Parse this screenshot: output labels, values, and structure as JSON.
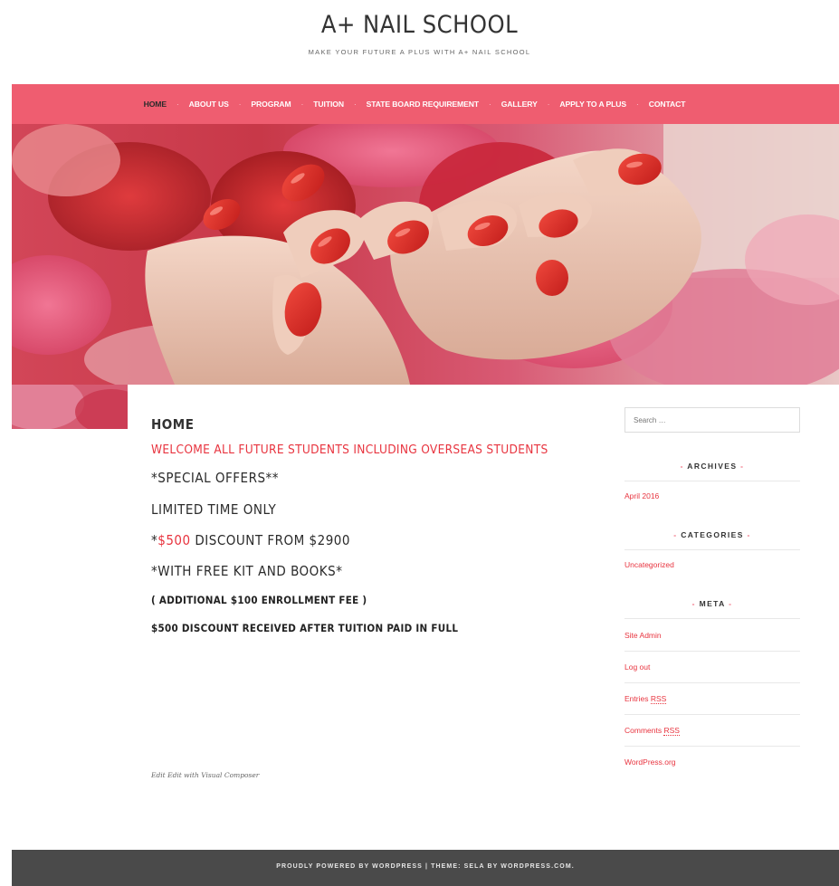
{
  "site": {
    "title": "A+ NAIL SCHOOL",
    "tagline": "MAKE YOUR FUTURE A PLUS WITH A+ NAIL SCHOOL"
  },
  "nav": {
    "items": [
      {
        "label": "HOME"
      },
      {
        "label": "ABOUT US"
      },
      {
        "label": "PROGRAM"
      },
      {
        "label": "TUITION"
      },
      {
        "label": "STATE BOARD REQUIREMENT"
      },
      {
        "label": "GALLERY"
      },
      {
        "label": "APPLY TO A PLUS"
      },
      {
        "label": "CONTACT"
      }
    ],
    "separator": "·",
    "active_color": "#2b2b2b"
  },
  "colors": {
    "accent": "#ef5d70",
    "highlight_red": "#e8343f",
    "footer_bg": "#4a4a4a"
  },
  "content": {
    "title": "HOME",
    "welcome": "WELCOME ALL FUTURE STUDENTS INCLUDING OVERSEAS STUDENTS",
    "special_offers": "*SPECIAL OFFERS**",
    "limited_time": "LIMITED TIME ONLY",
    "discount_prefix": "*",
    "discount_amount": "$500",
    "discount_suffix": " DISCOUNT FROM $2900",
    "free_kit": "*WITH FREE KIT AND BOOKS*",
    "enrollment_fee": "( ADDITIONAL $100 ENROLLMENT FEE )",
    "discount_note": "$500 DISCOUNT RECEIVED AFTER TUITION PAID IN FULL",
    "edit_link": "Edit",
    "edit_visual_composer": "Edit with Visual Composer"
  },
  "sidebar": {
    "search_placeholder": "Search …",
    "archives": {
      "title": "ARCHIVES",
      "items": [
        "April 2016"
      ]
    },
    "categories": {
      "title": "CATEGORIES",
      "items": [
        "Uncategorized"
      ]
    },
    "meta": {
      "title": "META",
      "items": [
        {
          "text": "Site Admin"
        },
        {
          "text": "Log out"
        },
        {
          "pre": "Entries ",
          "abbr": "RSS"
        },
        {
          "pre": "Comments ",
          "abbr": "RSS"
        },
        {
          "text": "WordPress.org"
        }
      ]
    }
  },
  "footer": {
    "powered": "PROUDLY POWERED BY WORDPRESS",
    "divider": "|",
    "theme": "THEME: SELA BY WORDPRESS.COM."
  },
  "hero": {
    "icon": "manicured-hands-with-rose-petals-image"
  }
}
